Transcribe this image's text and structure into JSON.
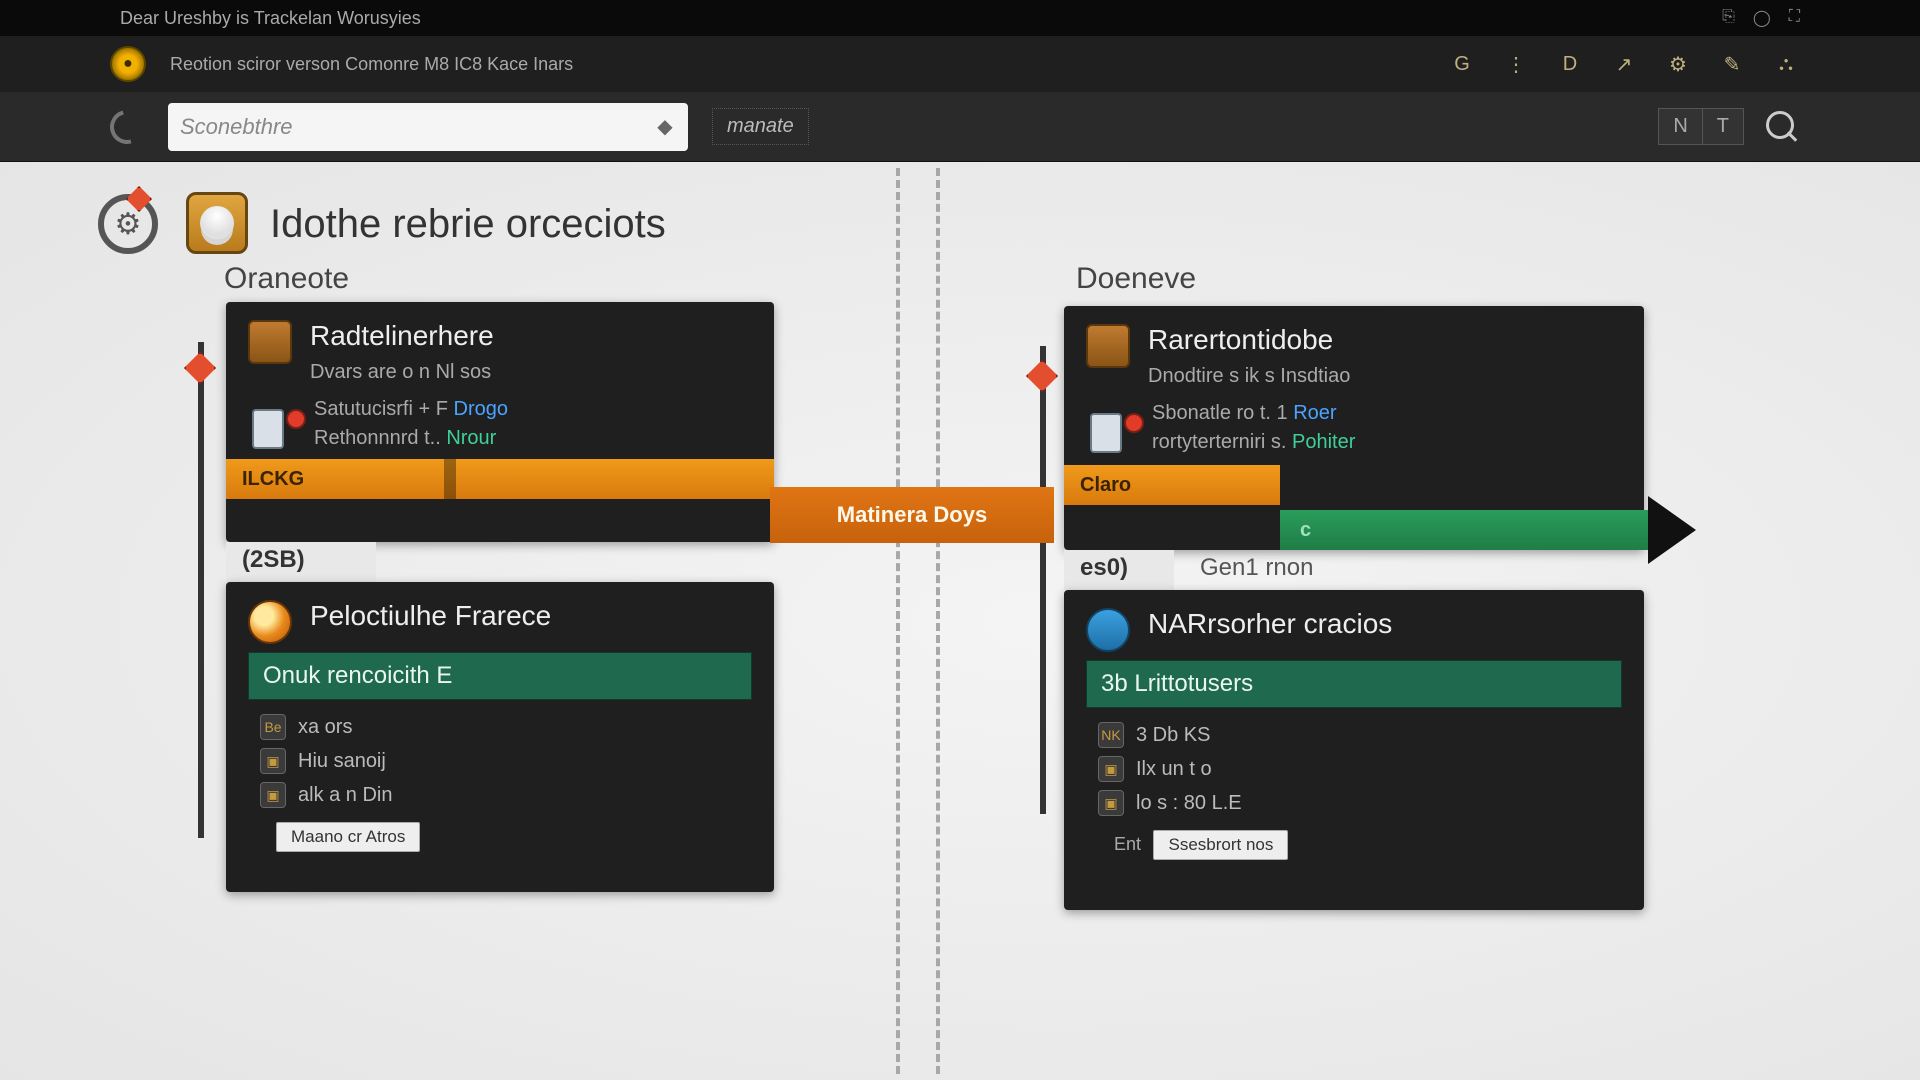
{
  "titlebar": {
    "text": "Dear Ureshby is Trackelan Worusyies",
    "right": [
      "⎘",
      "◯",
      "⛶"
    ]
  },
  "menubar": {
    "items_text": "Reotion sciror verson  Comonre  M8  IC8  Kace  Inars",
    "right_icons": [
      "G",
      "⋮",
      "D",
      "↗",
      "⚙",
      "✎",
      "⛬"
    ]
  },
  "toolbar": {
    "search_placeholder": "Sconebthre",
    "mode_label": "manate",
    "tabs": [
      "N",
      "T"
    ]
  },
  "page": {
    "title": "Idothe rebrie orceciots",
    "left_label": "Oraneote",
    "right_label": "Doeneve"
  },
  "connector": {
    "label": "Matinera Doys"
  },
  "left_upper": {
    "title": "Radtelinerhere",
    "line1": "Dvars are o n  Nl sos",
    "line2a": "Satutucisrfi + F  ",
    "line2b": "Drogo",
    "line3a": "Rethonnnrd t..  ",
    "line3b": "Nrour",
    "bar_label": "ILCKG",
    "below_label": "(2SB)"
  },
  "right_upper": {
    "title": "Rarertontidobe",
    "line1": "Dnodtire s ik s  Insdtiao",
    "line2a": "Sbonatle ro  t. 1  ",
    "line2b": "Roer",
    "line3a": "rortyterterniri s.  ",
    "line3b": "Pohiter",
    "bar_label": "Claro",
    "green_dim": "c",
    "below_label": "es0)",
    "below_extra": "Gen1 rnon"
  },
  "left_lower": {
    "title": "Peloctiulhe Frarece",
    "strip": "Onuk rencoicith E",
    "rows": [
      {
        "ico": "Be",
        "text": "xa ors"
      },
      {
        "ico": "▣",
        "text": "Hiu  sanoij"
      },
      {
        "ico": "▣",
        "text": "alk  a n Din"
      }
    ],
    "btn": "Maano cr Atros"
  },
  "right_lower": {
    "title": "NARrsorher cracios",
    "strip": "3b Lrittotusers",
    "rows": [
      {
        "ico": "NK",
        "text": "3 Db KS"
      },
      {
        "ico": "▣",
        "text": "Ilx  un t o"
      },
      {
        "ico": "▣",
        "text": "lo  s : 80 L.E"
      }
    ],
    "btn_prefix": "Ent",
    "btn": "Ssesbrort nos"
  }
}
